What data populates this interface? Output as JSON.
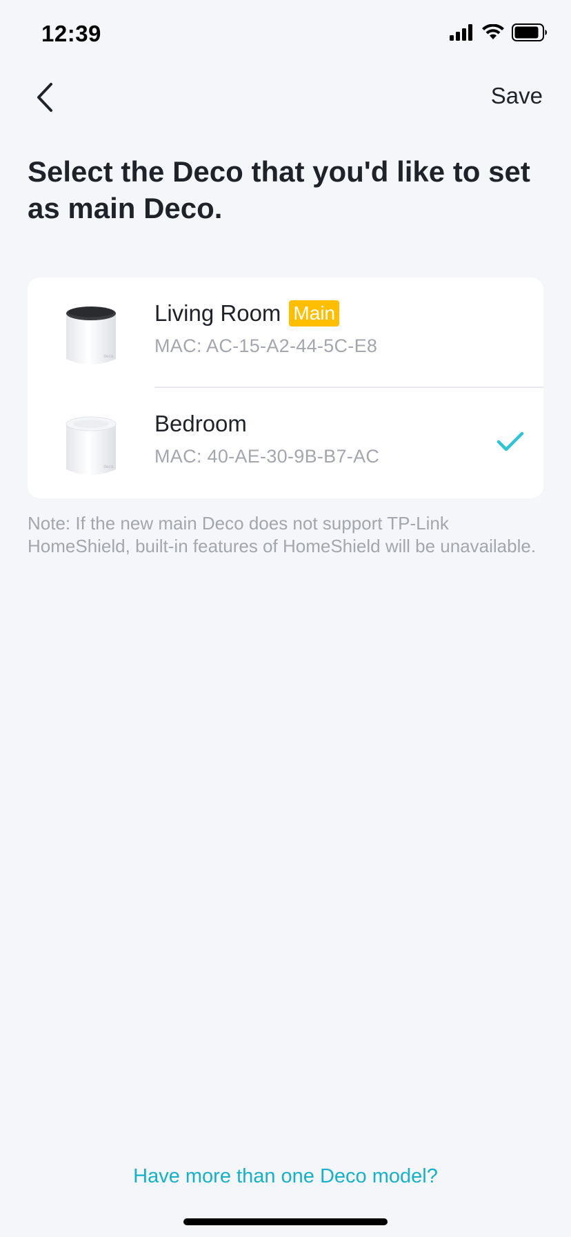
{
  "status_bar": {
    "time": "12:39",
    "icons": [
      "cellular-signal-icon",
      "wifi-icon",
      "battery-icon"
    ]
  },
  "nav": {
    "back_icon": "chevron-left-icon",
    "save_label": "Save"
  },
  "title": "Select the Deco that you'd like to set as main Deco.",
  "devices": [
    {
      "name": "Living Room",
      "badge": "Main",
      "mac": "MAC: AC-15-A2-44-5C-E8",
      "selected": false
    },
    {
      "name": "Bedroom",
      "badge": "",
      "mac": "MAC: 40-AE-30-9B-B7-AC",
      "selected": true
    }
  ],
  "note": "Note: If the new main Deco does not support TP-Link HomeShield, built-in features of HomeShield will be unavailable.",
  "footer_link": "Have more than one Deco model?",
  "colors": {
    "background": "#f5f6fa",
    "accent": "#14b1c9",
    "badge": "#ffbf00",
    "secondary_text": "#a3a6ad",
    "check": "#2ec4d8"
  }
}
